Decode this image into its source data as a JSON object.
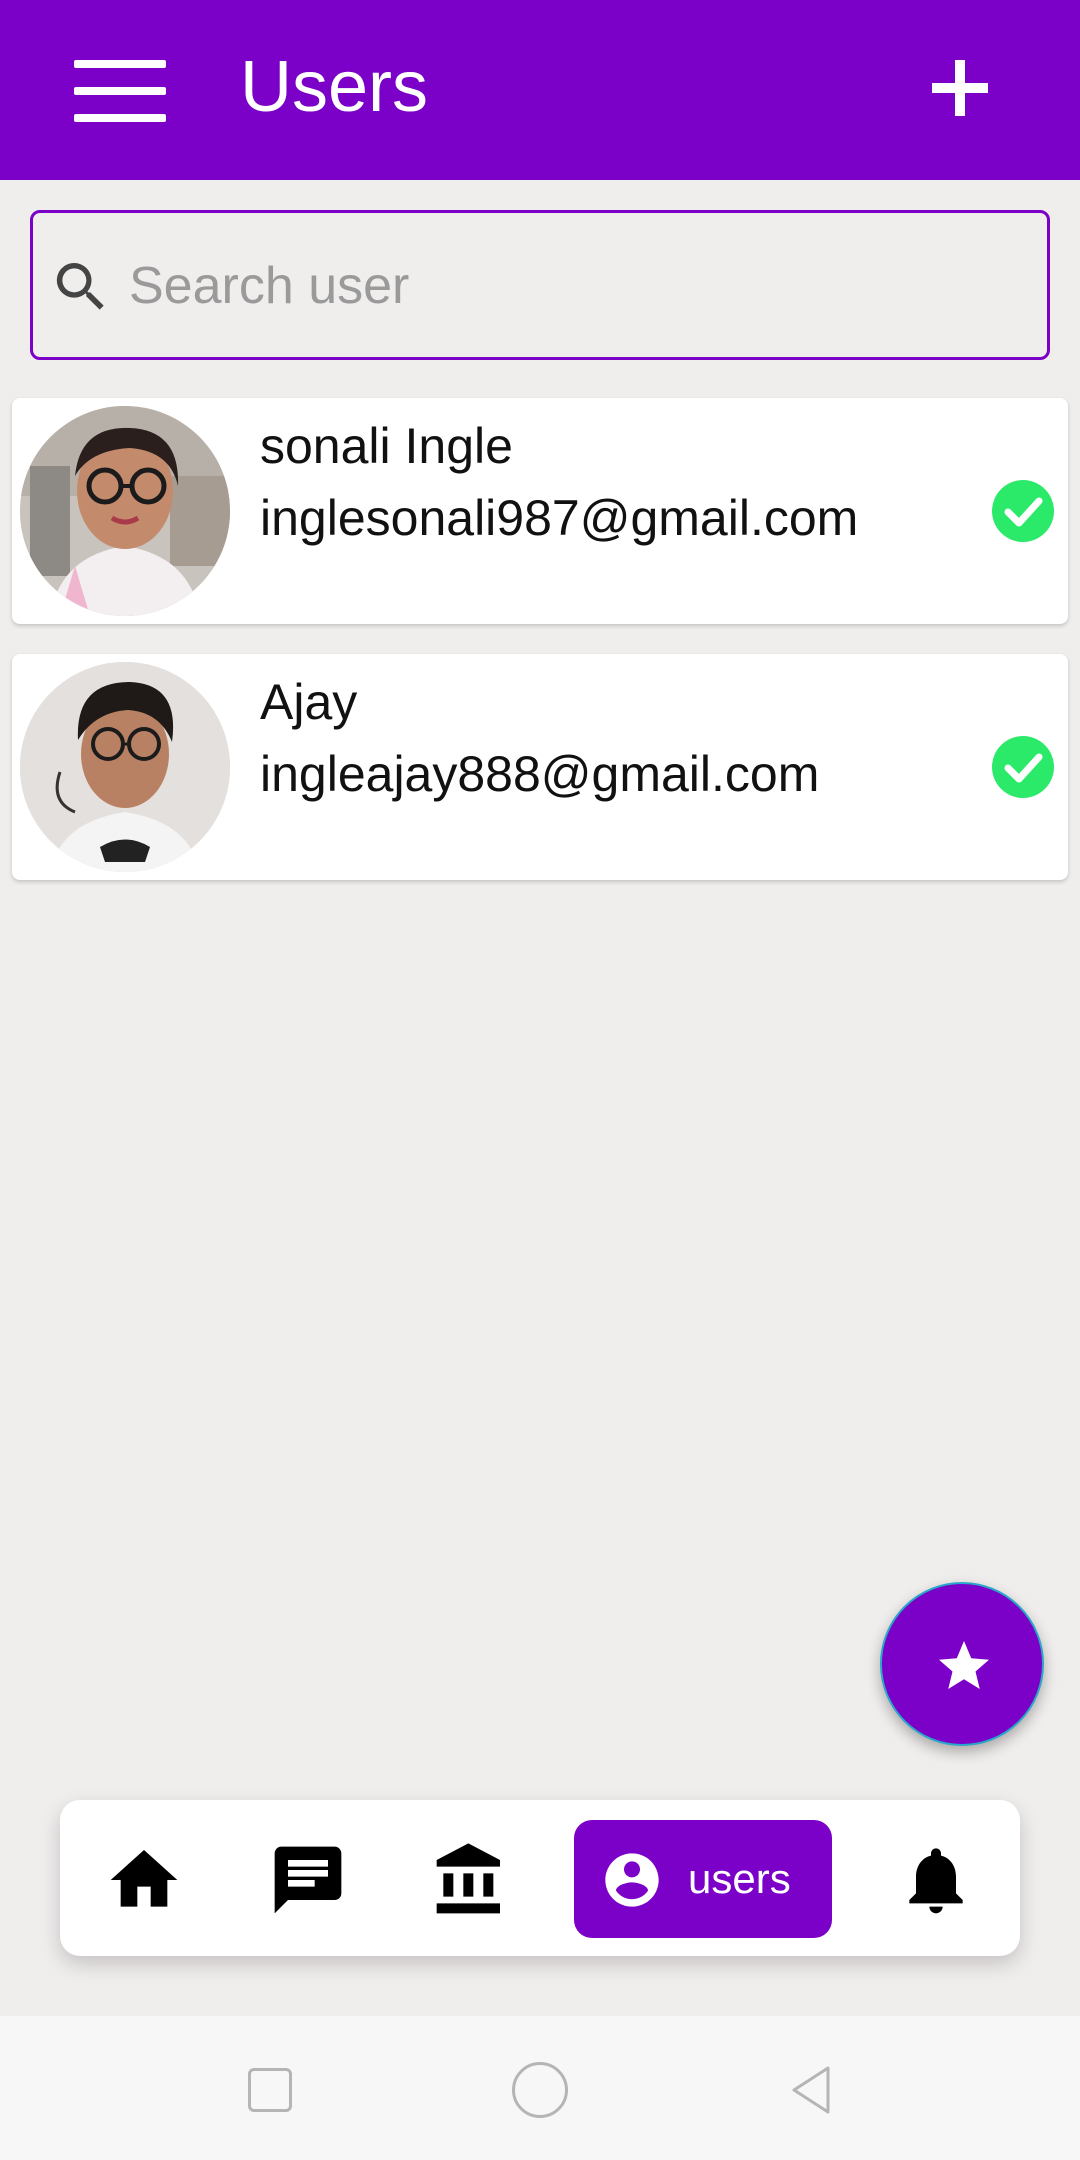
{
  "app": {
    "title": "Users",
    "accent_color": "#7b00c8",
    "icons": {
      "menu": "hamburger-menu-icon",
      "add": "plus-icon"
    }
  },
  "search": {
    "placeholder": "Search user",
    "value": "",
    "icon": "search-icon"
  },
  "users": [
    {
      "name": "sonali Ingle",
      "email": "inglesonali987@gmail.com",
      "verified": true,
      "status_color": "#2bea6a"
    },
    {
      "name": "Ajay",
      "email": "ingleajay888@gmail.com",
      "verified": true,
      "status_color": "#2bea6a"
    }
  ],
  "fab": {
    "icon": "star-icon"
  },
  "bottom_nav": {
    "items": [
      {
        "icon": "home-icon"
      },
      {
        "icon": "chat-icon"
      },
      {
        "icon": "bank-icon"
      },
      {
        "icon": "account-circle-icon",
        "label": "users",
        "active": true
      },
      {
        "icon": "bell-icon"
      }
    ]
  },
  "system_nav": {
    "icons": [
      "recent-apps-icon",
      "home-circle-icon",
      "back-triangle-icon"
    ]
  }
}
